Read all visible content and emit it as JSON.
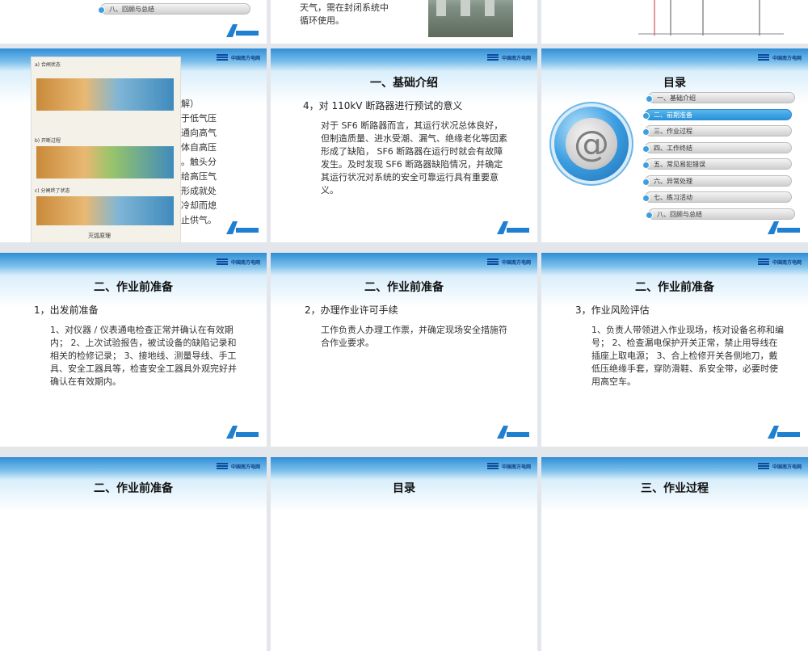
{
  "brand_text": "中国南方电网",
  "row0": {
    "left_toc_item": "八、回顾与总结",
    "mid_text_1": "天气，需在封闭系统中",
    "mid_text_2": "循环使用。"
  },
  "row1": {
    "left": {
      "partial_lines": [
        "解）",
        "于低气压",
        "通向高气",
        "体自高压",
        "。触头分",
        "给高压气",
        "形成就处",
        "冷却而熄",
        "止供气。"
      ],
      "diagram_labels": [
        "a) 合闸状态",
        "b) 开断过程",
        "c) 分闸终了状态",
        "灭弧原理"
      ]
    },
    "mid": {
      "title": "一、基础介绍",
      "subtitle": "4，对 110kV 断路器进行预试的意义",
      "body": "对于 SF6 断路器而言，其运行状况总体良好，但制造质量、进水受潮、漏气、绝缘老化等因素形成了缺陷， SF6 断路器在运行时就会有故障发生。及时发现 SF6 断路器缺陷情况，并确定其运行状况对系统的安全可靠运行具有重要意义。"
    },
    "right": {
      "title": "目录",
      "items": [
        {
          "label": "一、基础介绍",
          "active": false
        },
        {
          "label": "二、前期准备",
          "active": true
        },
        {
          "label": "三、作业过程",
          "active": false
        },
        {
          "label": "四、工作终结",
          "active": false
        },
        {
          "label": "五、常见易犯错误",
          "active": false
        },
        {
          "label": "六、异常处理",
          "active": false
        },
        {
          "label": "七、练习活动",
          "active": false
        },
        {
          "label": "八、回顾与总结",
          "active": false
        }
      ]
    }
  },
  "row2": {
    "left": {
      "title": "二、作业前准备",
      "subtitle": "1，出发前准备",
      "body": "1、对仪器 / 仪表通电检查正常并确认在有效期内； 2、上次试验报告，被试设备的缺陷记录和相关的检修记录； 3、接地线、测量导线、手工具、安全工器具等，检查安全工器具外观完好并确认在有效期内。"
    },
    "mid": {
      "title": "二、作业前准备",
      "subtitle": "2，办理作业许可手续",
      "body": "工作负责人办理工作票，并确定现场安全措施符合作业要求。"
    },
    "right": {
      "title": "二、作业前准备",
      "subtitle": "3，作业风险评估",
      "body": "1、负责人带领进入作业现场，核对设备名称和编号； 2、检查漏电保护开关正常，禁止用导线在插座上取电源； 3、合上检修开关各侧地刀，戴低压绝缘手套，穿防滑鞋、系安全带，必要时使用高空车。"
    }
  },
  "row3": {
    "left_title": "二、作业前准备",
    "mid_title": "目录",
    "right_title": "三、作业过程"
  }
}
